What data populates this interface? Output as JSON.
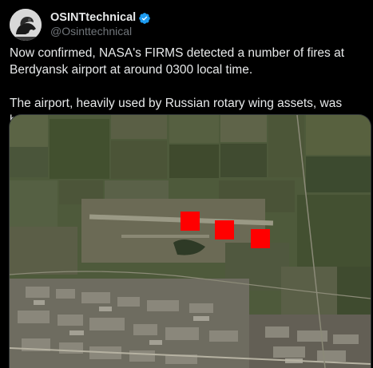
{
  "author": {
    "display_name": "OSINTtechnical",
    "handle": "@Osinttechnical",
    "verified": true,
    "avatar_icon": "avatar-icon",
    "verified_icon": "verified-badge-icon",
    "verified_color": "#1d9bf0"
  },
  "tweet": {
    "paragraphs": [
      "Now confirmed, NASA's FIRMS detected a number of fires at Berdyansk airport at around 0300 local time.",
      "The airport, heavily used by Russian rotary wing assets, was burning."
    ]
  },
  "media": {
    "type": "satellite-image",
    "fire_marker_color": "#ff0000",
    "fire_marker_count": 3
  }
}
